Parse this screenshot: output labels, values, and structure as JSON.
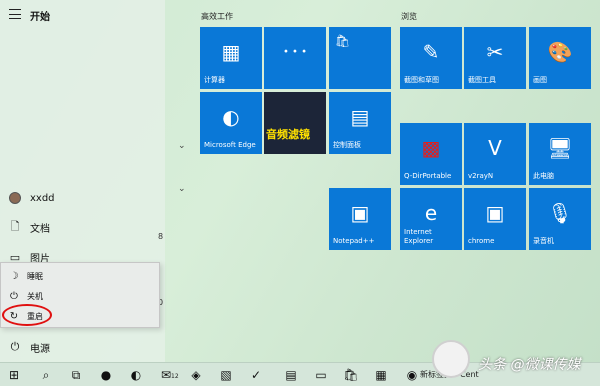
{
  "start": {
    "title": "开始",
    "user": "xxdd",
    "items": [
      "文档",
      "图片"
    ],
    "power": "电源",
    "side_numbers": [
      "8",
      "0"
    ]
  },
  "power_menu": {
    "items": [
      "睡眠",
      "关机",
      "重启"
    ]
  },
  "groups": {
    "productivity": "高效工作",
    "browse": "浏览"
  },
  "tiles": [
    {
      "label": "计算器",
      "icon": "calculator-icon"
    },
    {
      "label": "",
      "icon": "people-icon"
    },
    {
      "label": "",
      "icon": "store-icon"
    },
    {
      "label": "Microsoft Edge",
      "icon": "edge-icon"
    },
    {
      "label": "音频滤镜",
      "icon": "video-thumb"
    },
    {
      "label": "控制面板",
      "icon": "control-panel-icon"
    },
    {
      "label": "截图和草图",
      "icon": "snip-icon"
    },
    {
      "label": "截图工具",
      "icon": "scissors-icon"
    },
    {
      "label": "画图",
      "icon": "paint-icon"
    },
    {
      "label": "Q-DirPortable",
      "icon": "qdir-icon"
    },
    {
      "label": "v2rayN",
      "icon": "v2ray-icon"
    },
    {
      "label": "此电脑",
      "icon": "pc-icon"
    },
    {
      "label": "Notepad++",
      "icon": "notepad-icon"
    },
    {
      "label": "Internet Explorer",
      "icon": "ie-icon"
    },
    {
      "label": "chrome",
      "icon": "chrome-icon"
    },
    {
      "label": "录音机",
      "icon": "recorder-icon"
    }
  ],
  "taskbar": {
    "task_text": "新标签页 - Cent",
    "badge": "12"
  },
  "watermark": "头条 @微课传媒",
  "colors": {
    "tile": "#0a78d7",
    "highlight_ring": "#e01010"
  }
}
